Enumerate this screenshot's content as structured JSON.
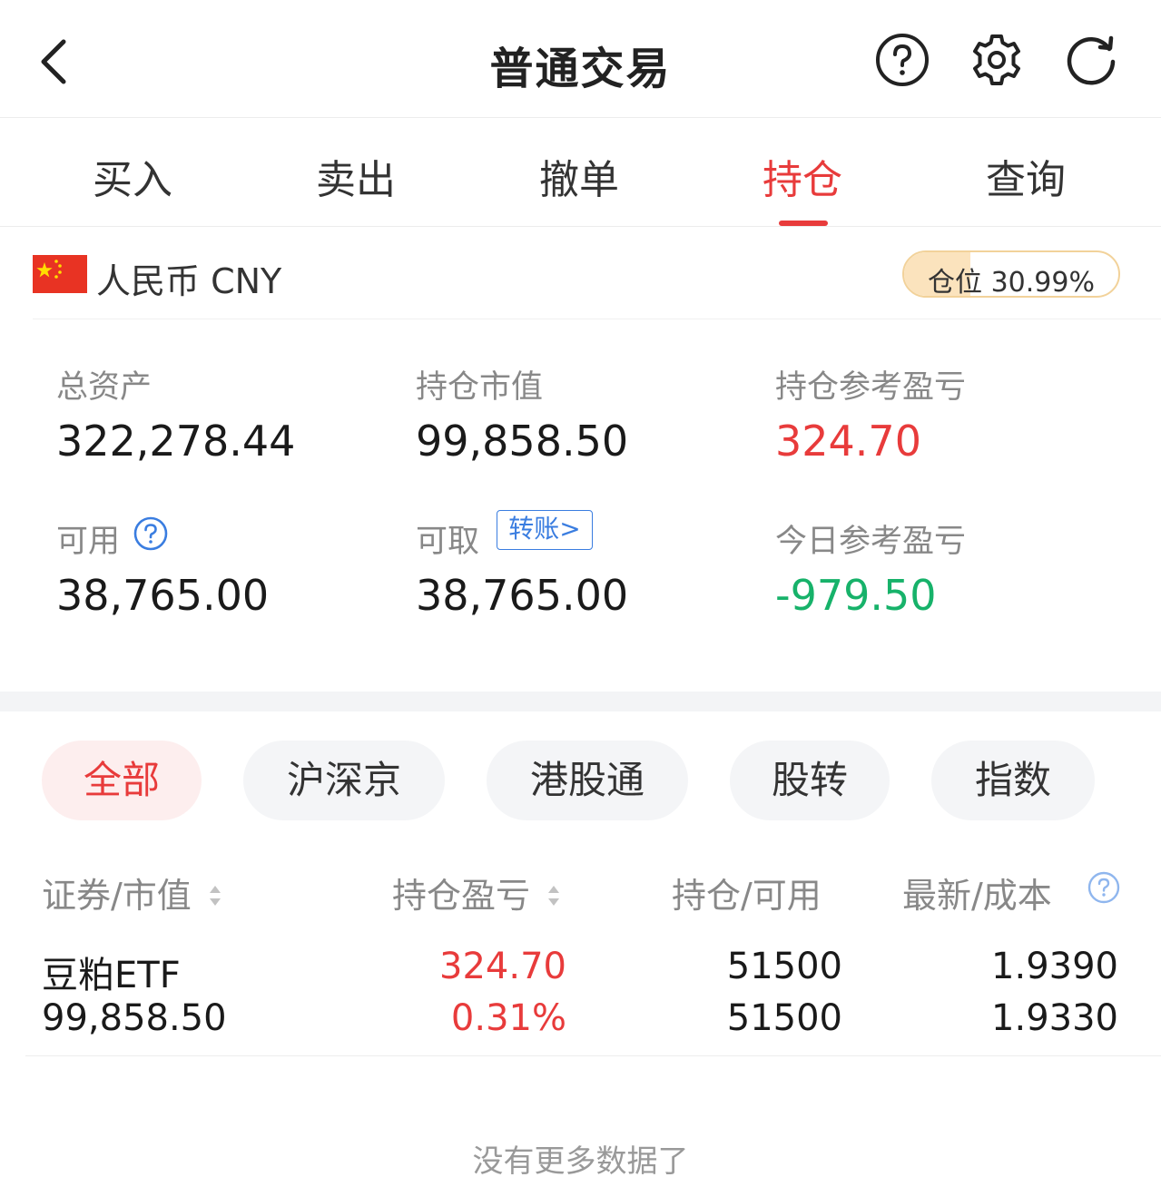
{
  "header": {
    "title": "普通交易",
    "icons": [
      "chevron-left-icon",
      "help-circle-icon",
      "gear-icon",
      "refresh-icon"
    ]
  },
  "tabs": [
    {
      "label": "买入",
      "active": false
    },
    {
      "label": "卖出",
      "active": false
    },
    {
      "label": "撤单",
      "active": false
    },
    {
      "label": "持仓",
      "active": true
    },
    {
      "label": "查询",
      "active": false
    }
  ],
  "account": {
    "currency": "人民币 CNY",
    "flag": "china-flag-icon",
    "position_label": "仓位 30.99%",
    "position_ratio": 0.3099
  },
  "summary": {
    "total_assets_label": "总资产",
    "total_assets": "322,278.44",
    "market_value_label": "持仓市值",
    "market_value": "99,858.50",
    "position_pnl_label": "持仓参考盈亏",
    "position_pnl": "324.70",
    "available_label": "可用",
    "available": "38,765.00",
    "withdrawable_label": "可取",
    "transfer_label": "转账>",
    "withdrawable": "38,765.00",
    "today_pnl_label": "今日参考盈亏",
    "today_pnl": "-979.50"
  },
  "filters": [
    {
      "label": "全部",
      "active": true
    },
    {
      "label": "沪深京",
      "active": false
    },
    {
      "label": "港股通",
      "active": false
    },
    {
      "label": "股转",
      "active": false
    },
    {
      "label": "指数",
      "active": false
    }
  ],
  "table": {
    "headers": [
      "证券/市值",
      "持仓盈亏",
      "持仓/可用",
      "最新/成本"
    ],
    "rows": [
      {
        "name": "豆粕ETF",
        "market_value": "99,858.50",
        "pnl": "324.70",
        "pnl_pct": "0.31%",
        "holding": "51500",
        "available": "51500",
        "latest": "1.9390",
        "cost": "1.9330"
      }
    ]
  },
  "footer": {
    "no_more": "没有更多数据了"
  },
  "colors": {
    "accent_red": "#e83b3b",
    "gain_red": "#e83b3b",
    "loss_green": "#17b26a",
    "link_blue": "#3a7de0"
  }
}
